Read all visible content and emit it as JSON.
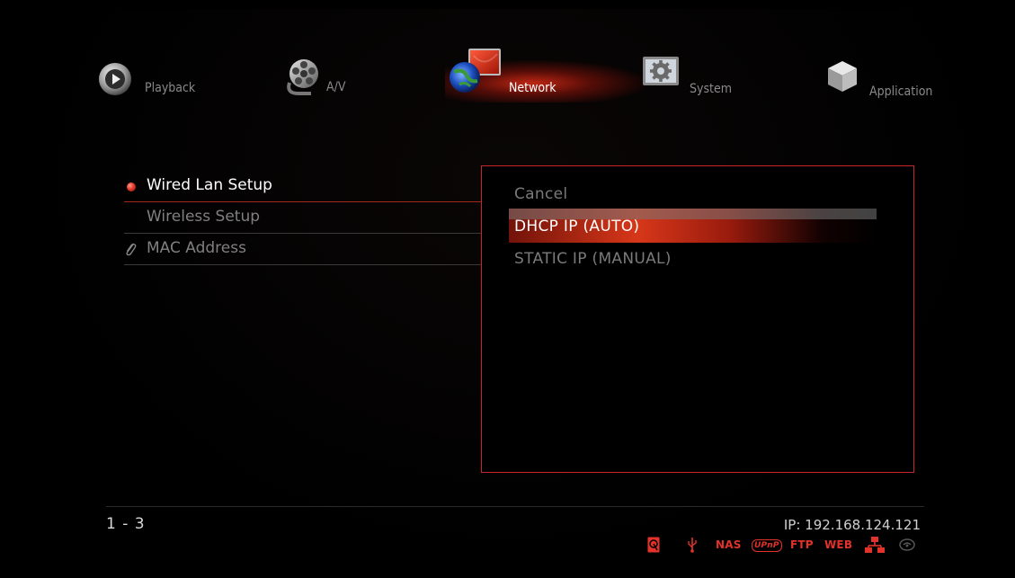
{
  "nav": {
    "items": [
      {
        "label": "Playback",
        "icon": "play-icon"
      },
      {
        "label": "A/V",
        "icon": "film-reel-icon"
      },
      {
        "label": "Network",
        "icon": "globe-network-icon",
        "active": true
      },
      {
        "label": "System",
        "icon": "gear-icon"
      },
      {
        "label": "Application",
        "icon": "cube-icon"
      }
    ]
  },
  "menu": {
    "items": [
      {
        "label": "Wired Lan Setup",
        "active": true
      },
      {
        "label": "Wireless Setup"
      },
      {
        "label": "MAC Address"
      }
    ]
  },
  "popup": {
    "options": [
      {
        "label": "Cancel"
      },
      {
        "label": "DHCP IP (AUTO)",
        "selected": true
      },
      {
        "label": "STATIC IP (MANUAL)"
      }
    ]
  },
  "footer": {
    "page": "1 - 3",
    "ip": "IP: 192.168.124.121",
    "status": {
      "nas": "NAS",
      "upnp": "UPnP",
      "ftp": "FTP",
      "web": "WEB"
    }
  },
  "colors": {
    "accent": "#c8252a",
    "highlight": "#d83719",
    "status_active": "#e2322a",
    "text_dim": "#7a7a7a"
  }
}
